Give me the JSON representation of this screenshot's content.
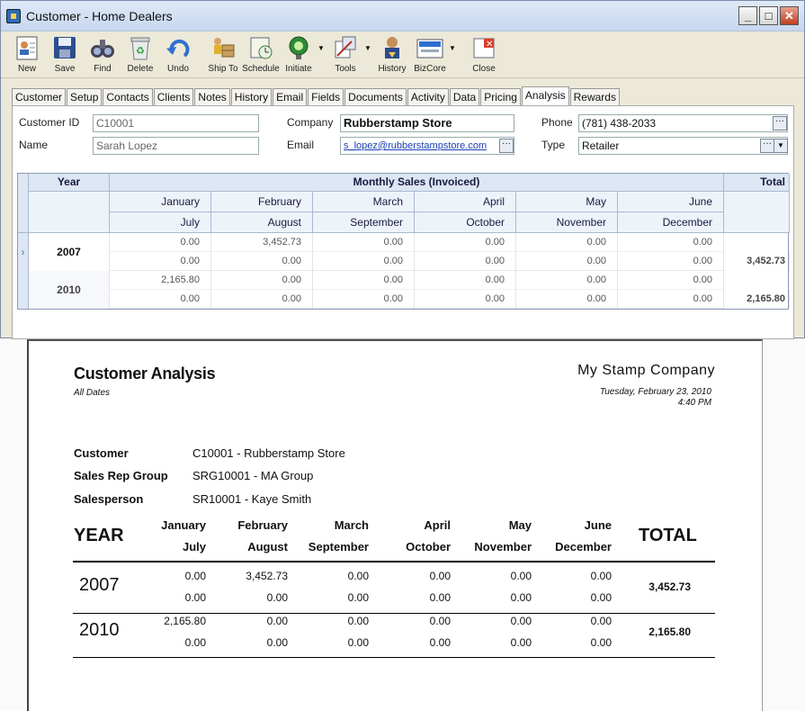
{
  "window": {
    "title": "Customer - Home Dealers",
    "controls": {
      "minimize": "_",
      "maximize": "□",
      "close": "✕"
    }
  },
  "toolbar": [
    {
      "label": "New",
      "icon": "new-customer-icon"
    },
    {
      "label": "Save",
      "icon": "save-icon"
    },
    {
      "label": "Find",
      "icon": "binoculars-icon"
    },
    {
      "label": "Delete",
      "icon": "recycle-bin-icon"
    },
    {
      "label": "Undo",
      "icon": "undo-icon"
    },
    {
      "label": "Ship To",
      "icon": "ship-to-icon"
    },
    {
      "label": "Schedule",
      "icon": "schedule-icon"
    },
    {
      "label": "Initiate",
      "icon": "initiate-icon"
    },
    {
      "label": "Tools",
      "icon": "tools-icon"
    },
    {
      "label": "History",
      "icon": "history-icon"
    },
    {
      "label": "BizCore",
      "icon": "bizcore-icon"
    },
    {
      "label": "Close",
      "icon": "close-doc-icon"
    }
  ],
  "tabs": [
    "Customer",
    "Setup",
    "Contacts",
    "Clients",
    "Notes",
    "History",
    "Email",
    "Fields",
    "Documents",
    "Activity",
    "Data",
    "Pricing",
    "Analysis",
    "Rewards"
  ],
  "active_tab": "Analysis",
  "form": {
    "customer_id_label": "Customer ID",
    "customer_id": "C10001",
    "name_label": "Name",
    "name": "Sarah Lopez",
    "company_label": "Company",
    "company": "Rubberstamp Store",
    "email_label": "Email",
    "email": "s_lopez@rubberstampstore.com",
    "phone_label": "Phone",
    "phone": "(781) 438-2033",
    "type_label": "Type",
    "type": "Retailer"
  },
  "grid": {
    "year_header": "Year",
    "group_header": "Monthly Sales (Invoiced)",
    "total_header": "Total",
    "months_top": [
      "January",
      "February",
      "March",
      "April",
      "May",
      "June"
    ],
    "months_bottom": [
      "July",
      "August",
      "September",
      "October",
      "November",
      "December"
    ],
    "rows": [
      {
        "year": "2007",
        "top": [
          "0.00",
          "3,452.73",
          "0.00",
          "0.00",
          "0.00",
          "0.00"
        ],
        "bottom": [
          "0.00",
          "0.00",
          "0.00",
          "0.00",
          "0.00",
          "0.00"
        ],
        "total": "3,452.73"
      },
      {
        "year": "2010",
        "top": [
          "2,165.80",
          "0.00",
          "0.00",
          "0.00",
          "0.00",
          "0.00"
        ],
        "bottom": [
          "0.00",
          "0.00",
          "0.00",
          "0.00",
          "0.00",
          "0.00"
        ],
        "total": "2,165.80"
      }
    ]
  },
  "report": {
    "title": "Customer Analysis",
    "subtitle": "All Dates",
    "company": "My Stamp Company",
    "date": "Tuesday, February 23, 2010",
    "time": "4:40 PM",
    "info": [
      {
        "label": "Customer",
        "value": "C10001 - Rubberstamp Store"
      },
      {
        "label": "Sales Rep Group",
        "value": "SRG10001 - MA Group"
      },
      {
        "label": "Salesperson",
        "value": "SR10001 - Kaye Smith"
      }
    ],
    "year_header": "YEAR",
    "total_header": "TOTAL",
    "months_top": [
      "January",
      "February",
      "March",
      "April",
      "May",
      "June"
    ],
    "months_bottom": [
      "July",
      "August",
      "September",
      "October",
      "November",
      "December"
    ],
    "rows": [
      {
        "year": "2007",
        "top": [
          "0.00",
          "3,452.73",
          "0.00",
          "0.00",
          "0.00",
          "0.00"
        ],
        "bottom": [
          "0.00",
          "0.00",
          "0.00",
          "0.00",
          "0.00",
          "0.00"
        ],
        "total": "3,452.73"
      },
      {
        "year": "2010",
        "top": [
          "2,165.80",
          "0.00",
          "0.00",
          "0.00",
          "0.00",
          "0.00"
        ],
        "bottom": [
          "0.00",
          "0.00",
          "0.00",
          "0.00",
          "0.00",
          "0.00"
        ],
        "total": "2,165.80"
      }
    ]
  }
}
